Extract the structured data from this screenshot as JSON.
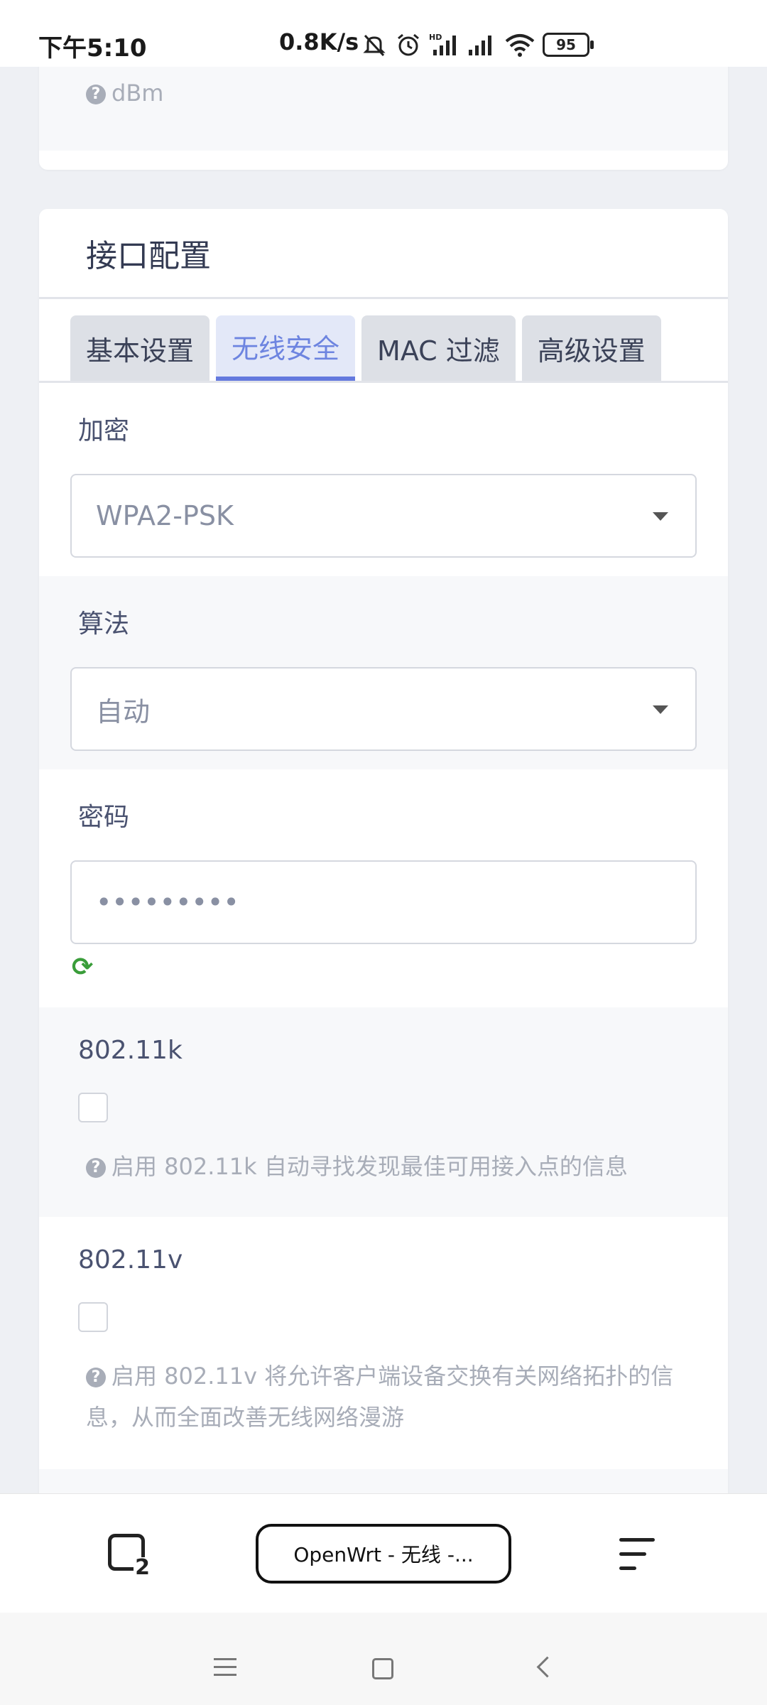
{
  "status": {
    "time": "下午5:10",
    "speed": "0.8K/s",
    "battery": "95"
  },
  "top_card": {
    "hint": "dBm"
  },
  "section": {
    "title": "接口配置",
    "tabs": [
      {
        "label": "基本设置",
        "active": false
      },
      {
        "label": "无线安全",
        "active": true
      },
      {
        "label": "MAC 过滤",
        "active": false
      },
      {
        "label": "高级设置",
        "active": false
      }
    ]
  },
  "fields": {
    "encryption": {
      "label": "加密",
      "value": "WPA2-PSK"
    },
    "cipher": {
      "label": "算法",
      "value": "自动"
    },
    "key": {
      "label": "密码",
      "value": "•••••••••"
    },
    "k80211": {
      "label": "802.11k",
      "checked": false,
      "hint": "启用 802.11k 自动寻找发现最佳可用接入点的信息"
    },
    "v80211": {
      "label": "802.11v",
      "checked": false,
      "hint": "启用 802.11v 将允许客户端设备交换有关网络拓扑的信息，从而全面改善无线网络漫游"
    }
  },
  "browser": {
    "tab_count": "2",
    "url_title": "OpenWrt - 无线 -..."
  },
  "icons": {
    "help": "question-circle-icon",
    "refresh": "refresh-icon",
    "tabs": "tabs-icon",
    "menu": "menu-icon"
  },
  "colors": {
    "accent": "#6479de",
    "hint": "#a8adb8",
    "refresh": "#3a9d3a"
  }
}
